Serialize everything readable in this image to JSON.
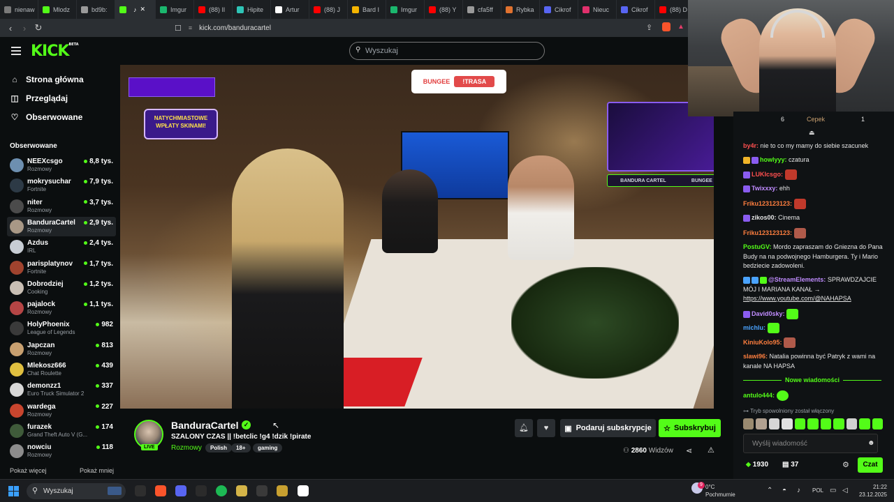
{
  "browser": {
    "tabs": [
      {
        "label": "nienaw",
        "color": "#7a7a7a",
        "active": false
      },
      {
        "label": "Mlodz",
        "color": "#53fc18",
        "active": false
      },
      {
        "label": "bd9b:",
        "color": "#9a9a9a",
        "active": false
      },
      {
        "label": "",
        "color": "#53fc18",
        "active": true
      },
      {
        "label": "Imgur",
        "color": "#1bb76e",
        "active": false
      },
      {
        "label": "(88) Il",
        "color": "#ff0000",
        "active": false
      },
      {
        "label": "Hipite",
        "color": "#2ec4b6",
        "active": false
      },
      {
        "label": "Artur",
        "color": "#ffffff",
        "active": false
      },
      {
        "label": "(88) J",
        "color": "#ff0000",
        "active": false
      },
      {
        "label": "Bard I",
        "color": "#f4b400",
        "active": false
      },
      {
        "label": "Imgur",
        "color": "#1bb76e",
        "active": false
      },
      {
        "label": "(88) Y",
        "color": "#ff0000",
        "active": false
      },
      {
        "label": "cfa5ff",
        "color": "#9a9a9a",
        "active": false
      },
      {
        "label": "Rybka",
        "color": "#e0722f",
        "active": false
      },
      {
        "label": "Cikrof",
        "color": "#5865f2",
        "active": false
      },
      {
        "label": "Nieuc",
        "color": "#e1306c",
        "active": false
      },
      {
        "label": "Cikrof",
        "color": "#5865f2",
        "active": false
      },
      {
        "label": "(88) D",
        "color": "#ff0000",
        "active": false
      }
    ],
    "url": "kick.com/banduracartel"
  },
  "header": {
    "logo": "KICK",
    "logo_beta": "BETA",
    "search_placeholder": "Wyszukaj"
  },
  "sidebar": {
    "nav": [
      {
        "label": "Strona główna",
        "icon": "home-icon",
        "glyph": "⌂"
      },
      {
        "label": "Przeglądaj",
        "icon": "browse-icon",
        "glyph": "◫"
      },
      {
        "label": "Obserwowane",
        "icon": "heart-icon",
        "glyph": "♡"
      }
    ],
    "following_title": "Obserwowane",
    "channels": [
      {
        "name": "NEEXcsgo",
        "category": "Rozmowy",
        "viewers": "8,8 tys.",
        "color": "#6d8fb0"
      },
      {
        "name": "mokrysuchar",
        "category": "Fortnite",
        "viewers": "7,9 tys.",
        "color": "#2d3a46"
      },
      {
        "name": "niter",
        "category": "Rozmowy",
        "viewers": "3,7 tys.",
        "color": "#4b4b4b"
      },
      {
        "name": "BanduraCartel",
        "category": "Rozmowy",
        "viewers": "2,9 tys.",
        "color": "#a89886",
        "selected": true
      },
      {
        "name": "Azdus",
        "category": "IRL",
        "viewers": "2,4 tys.",
        "color": "#c7cdd4"
      },
      {
        "name": "parisplatynov",
        "category": "Fortnite",
        "viewers": "1,7 tys.",
        "color": "#a0432e"
      },
      {
        "name": "Dobrodziej",
        "category": "Cooking",
        "viewers": "1,2 tys.",
        "color": "#c9bfb4"
      },
      {
        "name": "pajalock",
        "category": "Rozmowy",
        "viewers": "1,1 tys.",
        "color": "#b54545"
      },
      {
        "name": "HolyPhoenix",
        "category": "League of Legends",
        "viewers": "982",
        "color": "#3a3a3a"
      },
      {
        "name": "Japczan",
        "category": "Rozmowy",
        "viewers": "813",
        "color": "#c8a070"
      },
      {
        "name": "Mlekosz666",
        "category": "Chat Roulette",
        "viewers": "439",
        "color": "#e0c040"
      },
      {
        "name": "demonzz1",
        "category": "Euro Truck Simulator 2",
        "viewers": "337",
        "color": "#d8d8d8"
      },
      {
        "name": "wardega",
        "category": "Rozmowy",
        "viewers": "227",
        "color": "#c8452e"
      },
      {
        "name": "furazek",
        "category": "Grand Theft Auto V (G...",
        "viewers": "174",
        "color": "#3f5b3a"
      },
      {
        "name": "nowciu",
        "category": "Rozmowy",
        "viewers": "118",
        "color": "#8c8c8c"
      }
    ],
    "show_more": "Pokaż więcej",
    "show_less": "Pokaż mniej"
  },
  "video": {
    "overlay_promo": [
      "NATYCHMIASTOWE",
      "WPŁATY SKINAMI!"
    ],
    "overlay_bungee": "BUNGEE",
    "overlay_trasa": "!TRASA",
    "overlay_cam_left": "BANDURA CARTEL",
    "overlay_cam_right": "BUNGEE"
  },
  "stream": {
    "channel": "BanduraCartel",
    "live_badge": "LIVE",
    "title": "SZALONY CZAS || !betclic !g4 !dzik !pirate",
    "category": "Rozmowy",
    "tags": [
      "Polish",
      "18+",
      "gaming"
    ],
    "gift_label": "Podaruj subskrypcje",
    "subscribe_label": "Subskrybuj",
    "viewers_count": "2860",
    "viewers_label": "Widzów"
  },
  "chat": {
    "top_left": "6",
    "top_user": "Cepek",
    "top_right": "1",
    "messages": [
      {
        "user": "by4r:",
        "text": "nie to co my mamy do siebie szacunek",
        "color": "#ff4f4f",
        "badges": [],
        "emotes": []
      },
      {
        "user": "howlyyy:",
        "text": "czatura",
        "color": "#53fc18",
        "badges": [
          "#f0b429",
          "#8a5cf0"
        ],
        "emotes": []
      },
      {
        "user": "LUKIcsgo:",
        "text": "",
        "color": "#ff4f4f",
        "badges": [
          "#8a5cf0"
        ],
        "emotes": [
          "#c0392b"
        ]
      },
      {
        "user": "Twixxxy:",
        "text": "ehh",
        "color": "#c08cff",
        "badges": [
          "#8a5cf0"
        ],
        "emotes": []
      },
      {
        "user": "Friku123123123:",
        "text": "",
        "color": "#ff7f3f",
        "badges": [],
        "emotes": [
          "#c0392b"
        ]
      },
      {
        "user": "zikos00:",
        "text": "Cinema",
        "color": "#e6e6e6",
        "badges": [
          "#8a5cf0"
        ],
        "emotes": []
      },
      {
        "user": "Friku123123123:",
        "text": "",
        "color": "#ff7f3f",
        "badges": [],
        "emotes": [
          "#b05a4a"
        ]
      },
      {
        "user": "PostuGV:",
        "text": "Mordo zapraszam do Gniezna do Pana Budy na na podwojnego Hamburgera. Ty i Mario bedziecie zadowoleni.",
        "color": "#53fc18",
        "badges": [],
        "emotes": []
      },
      {
        "user": "@StreamElements:",
        "text": "SPRAWDZAJCIE MÓJ I MARIANA KANAŁ →",
        "link": "https://www.youtube.com/@NAHAPSA",
        "color": "#c08cff",
        "badges": [
          "#4aa3ff",
          "#4aa3ff",
          "#53fc18"
        ],
        "emotes": []
      },
      {
        "user": "David0sky:",
        "text": "",
        "color": "#c08cff",
        "badges": [
          "#8a5cf0"
        ],
        "emotes": [
          "#53fc18"
        ]
      },
      {
        "user": "michlu:",
        "text": "",
        "color": "#4aa3ff",
        "badges": [],
        "emotes": [
          "#53fc18"
        ]
      },
      {
        "user": "KiniuKolo95:",
        "text": "",
        "color": "#ff7f3f",
        "badges": [],
        "emotes": [
          "#b05a4a"
        ]
      },
      {
        "user": "slawi96:",
        "text": "Natalia powinna być Patryk z wami na kanale NA HAPSA",
        "color": "#ff7f3f",
        "badges": [],
        "emotes": []
      }
    ],
    "new_messages_label": "Nowe wiadomości",
    "last_message": {
      "user": "antulo444:",
      "color": "#53fc18",
      "emote": "#53fc18"
    },
    "slow_mode": "Tryb spowolniony został włączony",
    "emote_colors": [
      "#9a8a70",
      "#b0a090",
      "#d6d6d6",
      "#e0e0e0",
      "#53fc18",
      "#53fc18",
      "#53fc18",
      "#53fc18",
      "#d0d0d0",
      "#53fc18",
      "#53fc18"
    ],
    "input_placeholder": "Wyślij wiadomość",
    "points": "1930",
    "subs": "37",
    "send_label": "Czat"
  },
  "taskbar": {
    "search": "Wyszukaj",
    "weather_temp": "0°C",
    "weather_desc": "Pochmurnie",
    "weather_badge": "9",
    "lang": "POL",
    "time": "21:22",
    "date": "23.12.2025",
    "apps": [
      "#2e2e2e",
      "#fb542b",
      "#5865f2",
      "#2b2b2b",
      "#1db954",
      "#d4b448",
      "#3a3a3a",
      "#c8a030",
      "#ffffff"
    ]
  }
}
